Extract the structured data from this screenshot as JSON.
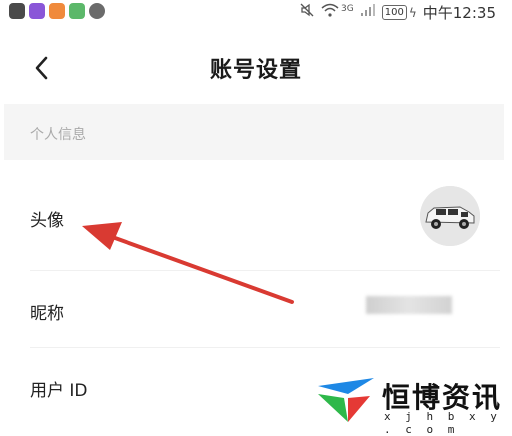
{
  "status_bar": {
    "network": "3G",
    "battery": "100",
    "time": "中午12:35",
    "app_icons": [
      "news-app-icon",
      "purple-app-icon",
      "orange-app-icon",
      "green-app-icon",
      "settings-app-icon"
    ]
  },
  "header": {
    "back_icon": "chevron-left-icon",
    "title": "账号设置"
  },
  "section": {
    "label": "个人信息"
  },
  "rows": {
    "avatar": {
      "label": "头像"
    },
    "nickname": {
      "label": "昵称"
    },
    "user_id": {
      "label": "用户 ID"
    }
  },
  "annotation": {
    "arrow_color": "#d93a32"
  },
  "watermark": {
    "name": "恒博资讯",
    "url": "x j h b x y . c o m"
  }
}
